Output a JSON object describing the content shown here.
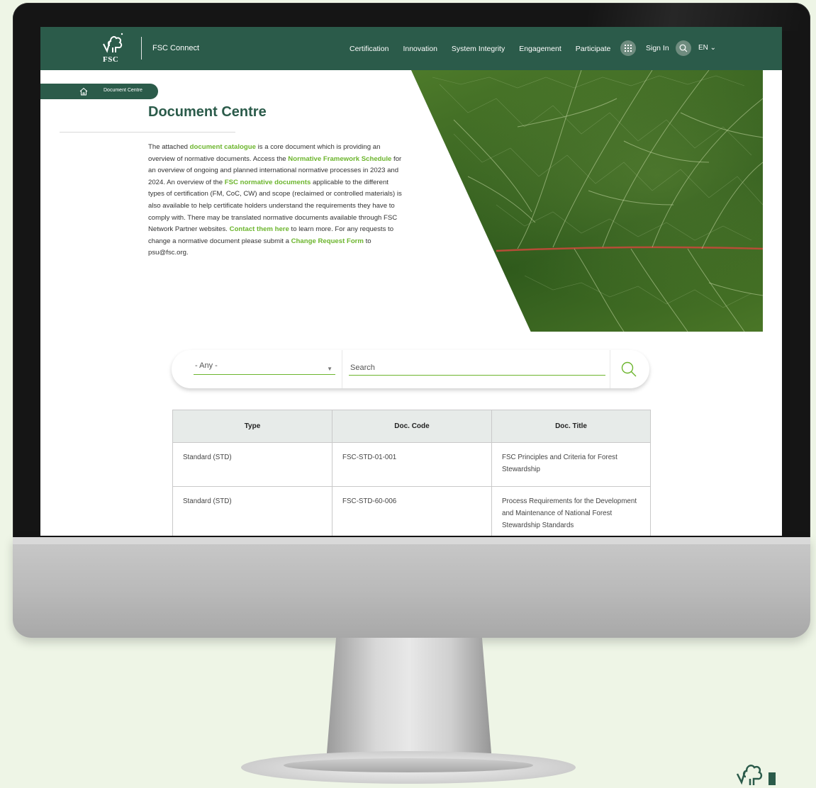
{
  "header": {
    "logo_text": "FSC",
    "brand": "FSC Connect",
    "nav": [
      "Certification",
      "Innovation",
      "System Integrity",
      "Engagement",
      "Participate"
    ],
    "sign_in": "Sign In",
    "language": "EN ⌄"
  },
  "breadcrumb": {
    "current": "Document Centre"
  },
  "page": {
    "title": "Document Centre",
    "intro": {
      "p1": "The attached ",
      "link1": "document catalogue",
      "p2": " is a core document which is providing an overview of normative documents. Access the ",
      "link2": "Normative Framework Schedule",
      "p3": " for an overview of ongoing and planned international normative processes in 2023 and 2024. An overview of the ",
      "link3": "FSC normative documents",
      "p4": " applicable to the different types of certification (FM, CoC, CW) and scope (reclaimed or controlled materials) is also available to help certificate holders understand the requirements they have to comply with. There may be translated normative documents available through FSC Network Partner websites. ",
      "link4": "Contact them here",
      "p5": " to learn more. For any requests to change a normative document please submit a ",
      "link5": "Change Request Form",
      "p6": " to psu@fsc.org."
    }
  },
  "search": {
    "filter_value": "- Any -",
    "placeholder": "Search"
  },
  "table": {
    "headers": [
      "Type",
      "Doc. Code",
      "Doc. Title"
    ],
    "rows": [
      [
        "Standard (STD)",
        "FSC-STD-01-001",
        "FSC Principles and Criteria for Forest Stewardship"
      ],
      [
        "Standard (STD)",
        "FSC-STD-60-006",
        "Process Requirements for the Development and Maintenance of National Forest Stewardship Standards"
      ]
    ]
  },
  "colors": {
    "header_green": "#2b5b4a",
    "link_green": "#6cb52d",
    "page_background": "#eef5e6"
  },
  "icons": [
    "fsc-tree-logo",
    "apps-grid-icon",
    "search-icon",
    "home-icon",
    "chevron-down-icon"
  ]
}
